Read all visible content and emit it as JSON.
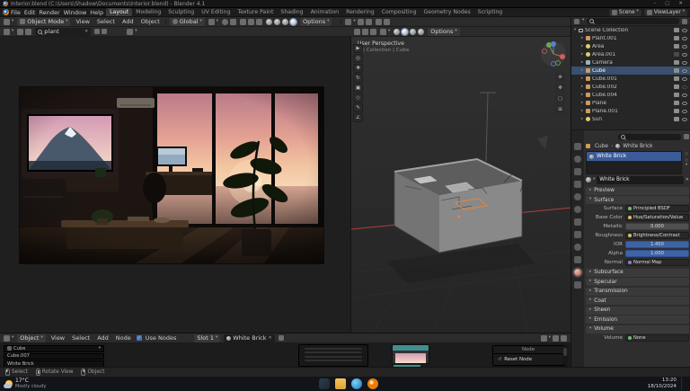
{
  "window": {
    "title": "Interior.blend (C:\\Users\\Shadow\\Documents\\Interior.blend) - Blender 4.1"
  },
  "topbar": {
    "menus": [
      "File",
      "Edit",
      "Render",
      "Window",
      "Help"
    ],
    "tabs": [
      "Layout",
      "Modeling",
      "Sculpting",
      "UV Editing",
      "Texture Paint",
      "Shading",
      "Animation",
      "Rendering",
      "Compositing",
      "Geometry Nodes",
      "Scripting"
    ],
    "scene_name": "Scene",
    "view_layer_name": "ViewLayer"
  },
  "viewport_header": {
    "mode": "Object Mode",
    "menus": [
      "View",
      "Select",
      "Add",
      "Object"
    ],
    "orientation": "Global",
    "options": "Options"
  },
  "image_editor": {
    "image_name": "plant"
  },
  "viewport": {
    "view_label": "User Perspective",
    "context_label": "(1) Collection | Cube"
  },
  "outliner": {
    "items": [
      {
        "name": "Scene Collection"
      },
      {
        "name": "Plant.001"
      },
      {
        "name": "Area"
      },
      {
        "name": "Area.001"
      },
      {
        "name": "Camera"
      },
      {
        "name": "Cube"
      },
      {
        "name": "Cube.001"
      },
      {
        "name": "Cube.002"
      },
      {
        "name": "Cube.004"
      },
      {
        "name": "Plane"
      },
      {
        "name": "Plane.001"
      },
      {
        "name": "Sun"
      }
    ]
  },
  "properties": {
    "breadcrumb_object": "Cube",
    "breadcrumb_material": "White Brick",
    "slot_material": "White Brick",
    "name_field": "White Brick",
    "preview_section": "Preview",
    "surface_section": "Surface",
    "rows": [
      {
        "label": "Surface",
        "value": "Principled BSDF"
      },
      {
        "label": "Base Color",
        "value": "Hue/Saturation/Value"
      },
      {
        "label": "Metallic",
        "value": "0.000"
      },
      {
        "label": "Roughness",
        "value": "Brightness/Contrast"
      },
      {
        "label": "IOR",
        "value": "1.450"
      },
      {
        "label": "Alpha",
        "value": "1.000"
      },
      {
        "label": "Normal",
        "value": "Normal Map"
      }
    ],
    "collapsed_sections": [
      "Subsurface",
      "Specular",
      "Transmission",
      "Coat",
      "Sheen",
      "Emission"
    ],
    "volume_section": "Volume",
    "volume_label": "Volume",
    "volume_value": "None"
  },
  "shader_editor": {
    "shader_type": "Object",
    "menus": [
      "View",
      "Select",
      "Add",
      "Node"
    ],
    "use_nodes": "Use Nodes",
    "slot": "Slot 1",
    "material": "White Brick",
    "path": [
      "Cube",
      "Cube.007",
      "White Brick"
    ],
    "context_menu_title": "Node",
    "context_menu_item": "Reset Node"
  },
  "statusbar": {
    "hints": [
      "Select",
      "Rotate View",
      "Object"
    ]
  },
  "taskbar": {
    "weather_temp": "17°C",
    "weather_desc": "Mostly cloudy",
    "time": "13:20",
    "date": "18/10/2024"
  },
  "colors": {
    "accent_blue": "#4772b3",
    "selection_orange": "#e8843c",
    "slot_selected": "#39506e",
    "sunset_sky": "#e8a79b",
    "node_teal": "#3f8f8f"
  }
}
